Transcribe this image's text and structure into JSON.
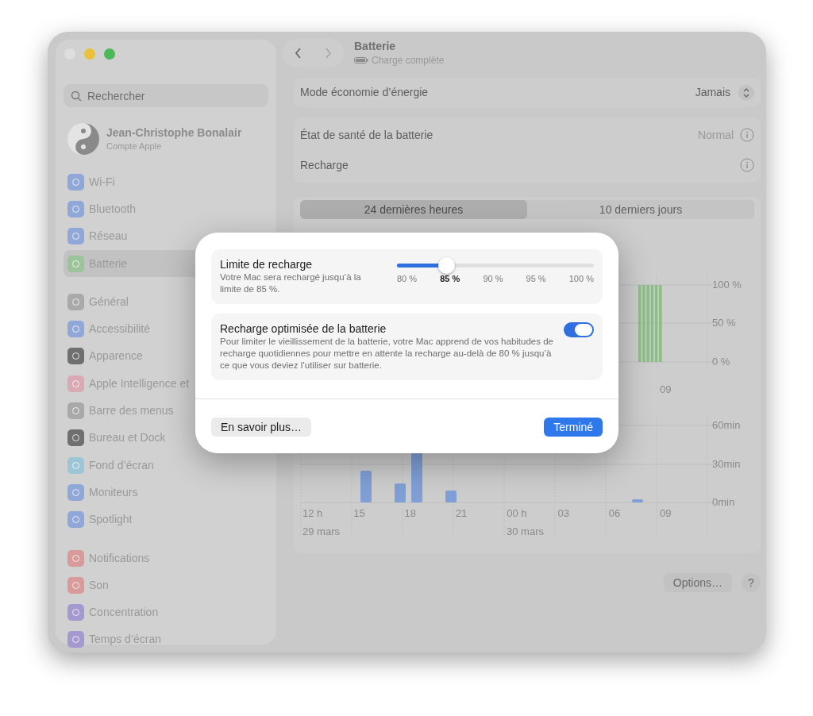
{
  "sidebar": {
    "search": {
      "placeholder": "Rechercher"
    },
    "account": {
      "name": "Jean-Christophe Bonalair",
      "subtitle": "Compte Apple"
    },
    "groups": [
      [
        {
          "label": "Wi-Fi",
          "color": "#8fa8d8",
          "selected": false
        },
        {
          "label": "Bluetooth",
          "color": "#8fa8d8",
          "selected": false
        },
        {
          "label": "Réseau",
          "color": "#8fa8d8",
          "selected": false
        },
        {
          "label": "Batterie",
          "color": "#9cc49a",
          "selected": true
        }
      ],
      [
        {
          "label": "Général",
          "color": "#a9a9a9",
          "selected": false
        },
        {
          "label": "Accessibilité",
          "color": "#8fa8d8",
          "selected": false
        },
        {
          "label": "Apparence",
          "color": "#6f6f6f",
          "selected": false
        },
        {
          "label": "Apple Intelligence et",
          "color": "#d9a9b4",
          "selected": false
        },
        {
          "label": "Barre des menus",
          "color": "#a9a9a9",
          "selected": false
        },
        {
          "label": "Bureau et Dock",
          "color": "#6f6f6f",
          "selected": false
        },
        {
          "label": "Fond d’écran",
          "color": "#9cc6d6",
          "selected": false
        },
        {
          "label": "Moniteurs",
          "color": "#8fa8d8",
          "selected": false
        },
        {
          "label": "Spotlight",
          "color": "#8fa8d8",
          "selected": false
        }
      ],
      [
        {
          "label": "Notifications",
          "color": "#d99a9a",
          "selected": false
        },
        {
          "label": "Son",
          "color": "#d99a9a",
          "selected": false
        },
        {
          "label": "Concentration",
          "color": "#a59ad0",
          "selected": false
        },
        {
          "label": "Temps d’écran",
          "color": "#a59ad0",
          "selected": false
        }
      ]
    ]
  },
  "header": {
    "title": "Batterie",
    "subtitle": "Charge complète"
  },
  "energy_mode": {
    "label": "Mode économie d’énergie",
    "value": "Jamais"
  },
  "health_rows": [
    {
      "label": "État de santé de la batterie",
      "value": "Normal"
    },
    {
      "label": "Recharge"
    }
  ],
  "range_tabs": [
    {
      "label": "24 dernières heures",
      "selected": true
    },
    {
      "label": "10 derniers jours",
      "selected": false
    }
  ],
  "level_chart": {
    "y_labels": [
      "100 %",
      "50 %",
      "0 %"
    ],
    "x_labels": [
      "09"
    ]
  },
  "usage_chart": {
    "y_labels": [
      "60min",
      "30min",
      "0min"
    ],
    "x_labels": [
      "12 h",
      "15",
      "18",
      "21",
      "00 h",
      "03",
      "06",
      "09"
    ],
    "date_labels": [
      "29 mars",
      "30 mars"
    ]
  },
  "footer": {
    "options": "Options…",
    "help": "?"
  },
  "dialog": {
    "limit": {
      "title": "Limite de recharge",
      "description": "Votre Mac sera rechargé jusqu’à la limite de 85 %.",
      "level": 0.25,
      "ticks": [
        {
          "label": "80 %",
          "selected": false
        },
        {
          "label": "85 %",
          "selected": true
        },
        {
          "label": "90 %",
          "selected": false
        },
        {
          "label": "95 %",
          "selected": false
        },
        {
          "label": "100 %",
          "selected": false
        }
      ]
    },
    "optimized": {
      "title": "Recharge optimisée de la batterie",
      "description": "Pour limiter le vieillissement de la batterie, votre Mac apprend de vos habitudes de recharge quotidiennes pour mettre en attente la recharge au-delà de 80 % jusqu’à ce que vous deviez l’utiliser sur batterie.",
      "on": true
    },
    "learn_more": "En savoir plus…",
    "done": "Terminé"
  }
}
